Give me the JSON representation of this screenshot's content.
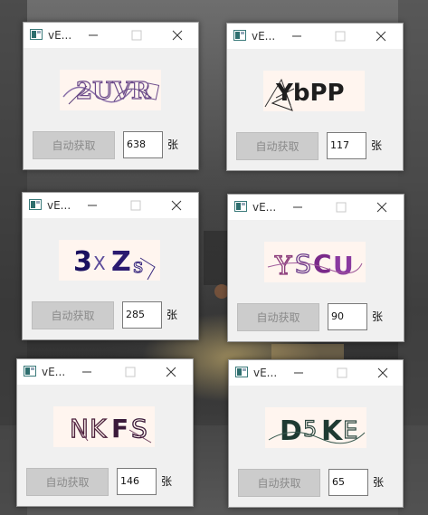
{
  "windows": [
    {
      "title": "vE...",
      "button_label": "自动获取",
      "count": "638",
      "unit": "张",
      "captcha_text": "2UVR"
    },
    {
      "title": "vE...",
      "button_label": "自动获取",
      "count": "117",
      "unit": "张",
      "captcha_text": "YbPP"
    },
    {
      "title": "vE...",
      "button_label": "自动获取",
      "count": "285",
      "unit": "张",
      "captcha_text": "3XZs"
    },
    {
      "title": "vE...",
      "button_label": "自动获取",
      "count": "90",
      "unit": "张",
      "captcha_text": "YSCU"
    },
    {
      "title": "vE...",
      "button_label": "自动获取",
      "count": "146",
      "unit": "张",
      "captcha_text": "NKFS"
    },
    {
      "title": "vE...",
      "button_label": "自动获取",
      "count": "65",
      "unit": "张",
      "captcha_text": "D5KE"
    }
  ]
}
